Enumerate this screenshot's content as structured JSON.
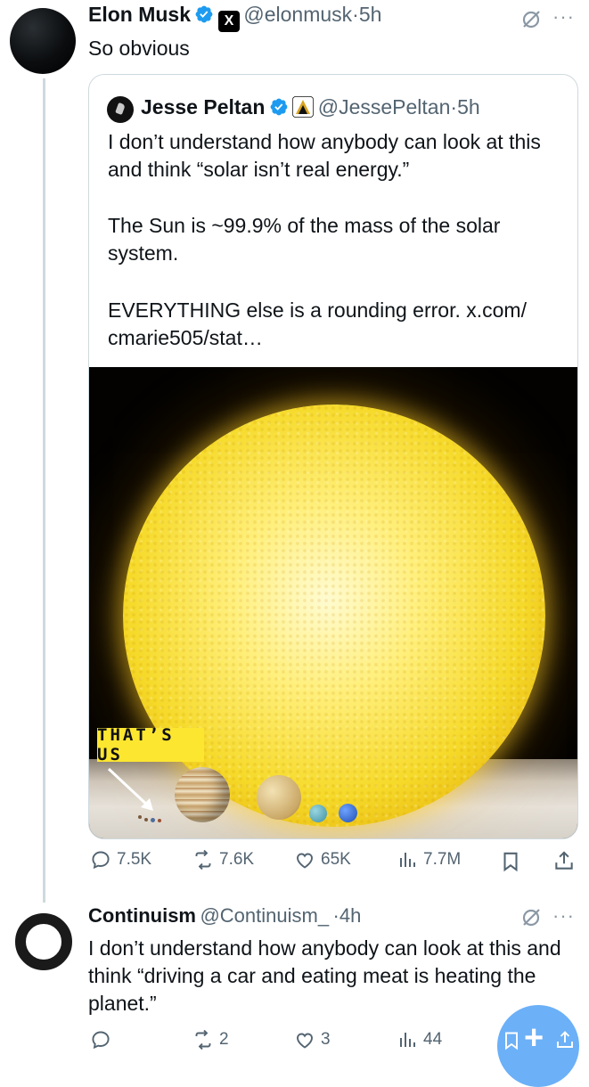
{
  "tweet": {
    "name": "Elon Musk",
    "handle": "@elonmusk",
    "sep": "·",
    "time": "5h",
    "text": "So obvious",
    "affiliate_badge": "X",
    "more": "···"
  },
  "quote": {
    "name": "Jesse Peltan",
    "handle": "@JessePeltan",
    "sep": "·",
    "time": "5h",
    "para1": "I don’t understand how anybody can look at this and think “solar isn’t real energy.”",
    "para2": "The Sun is ~99.9% of the mass of the solar system.",
    "para3": "EVERYTHING else is a rounding error. x.com/ cmarie505/stat…",
    "media_label": "THAT’S US"
  },
  "tweet_actions": {
    "replies": "7.5K",
    "reposts": "7.6K",
    "likes": "65K",
    "views": "7.7M"
  },
  "reply": {
    "name": "Continuism",
    "handle": "@Continuism_",
    "sep": "·",
    "time": "4h",
    "text": "I don’t understand how anybody can look at this and think “driving a car and eating meat is heating the planet.”",
    "more": "···"
  },
  "reply_actions": {
    "replies": "",
    "reposts": "2",
    "likes": "3",
    "views": "44"
  },
  "fab": {
    "label": "+"
  },
  "colors": {
    "accent": "#1d9bf0",
    "secondary_text": "#536471",
    "border": "#cfd9de"
  }
}
